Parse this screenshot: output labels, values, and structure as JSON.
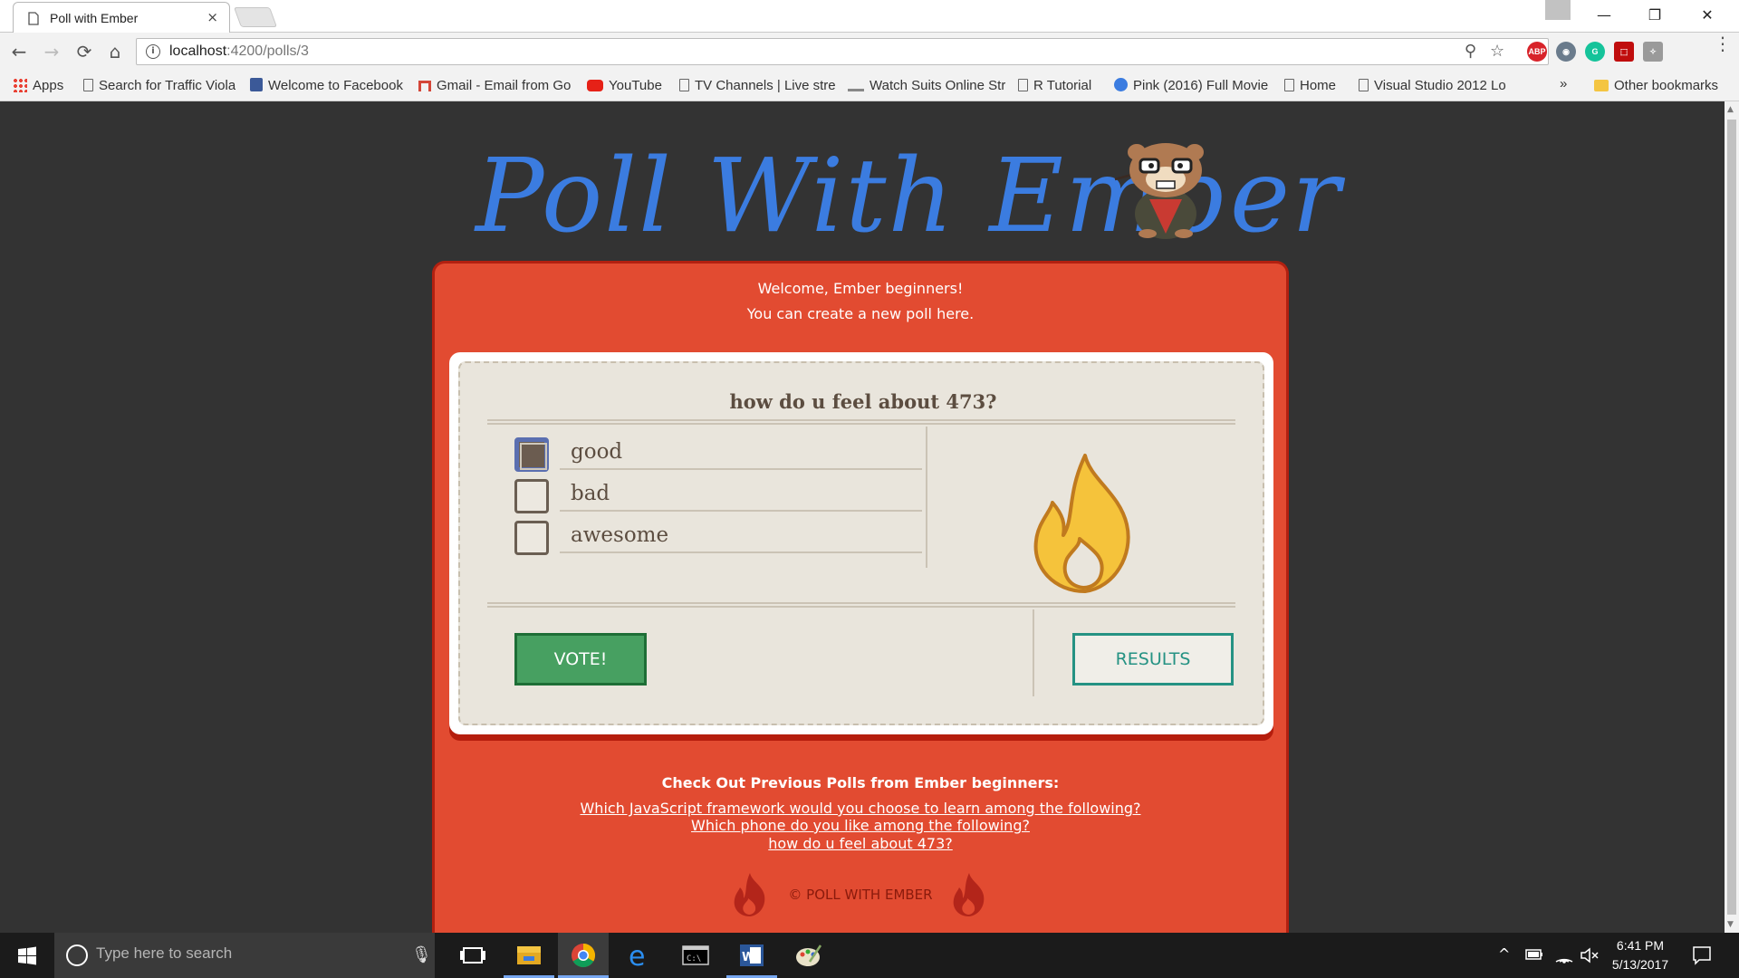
{
  "browser": {
    "tab_title": "Poll with Ember",
    "tab_close": "×",
    "window_minimize": "—",
    "window_restore": "❐",
    "window_close": "✕",
    "nav_back": "←",
    "nav_forward": "→",
    "nav_reload": "⟳",
    "nav_home": "⌂",
    "url_host": "localhost",
    "url_rest": ":4200/polls/3",
    "zoom_icon": "⚲",
    "star_icon": "☆",
    "extensions": [
      {
        "name": "adblock-plus",
        "label": "ABP",
        "color": "#d8232a"
      },
      {
        "name": "eye-extension",
        "label": "◉",
        "color": "#6a7b8c"
      },
      {
        "name": "grammarly",
        "label": "G",
        "color": "#15c39a"
      },
      {
        "name": "acrobat",
        "label": "⬚",
        "color": "#c00d0d"
      },
      {
        "name": "puzzle-extension",
        "label": "✧",
        "color": "#9a9a9a"
      }
    ],
    "menu": "⋮",
    "bookmarks": [
      {
        "label": "Apps",
        "icon": "apps-icon"
      },
      {
        "label": "Search for Traffic Viola",
        "icon": "doc-icon"
      },
      {
        "label": "Welcome to Facebook",
        "icon": "facebook-icon"
      },
      {
        "label": "Gmail - Email from Go",
        "icon": "gmail-icon"
      },
      {
        "label": "YouTube",
        "icon": "youtube-icon"
      },
      {
        "label": "TV Channels | Live stre",
        "icon": "doc-icon"
      },
      {
        "label": "Watch Suits Online Str",
        "icon": "plane-icon"
      },
      {
        "label": "R Tutorial",
        "icon": "doc-icon"
      },
      {
        "label": "Pink (2016) Full Movie",
        "icon": "play-icon"
      },
      {
        "label": "Home",
        "icon": "doc-icon"
      },
      {
        "label": "Visual Studio 2012 Lo",
        "icon": "doc-icon"
      }
    ],
    "bookmarks_overflow": "»",
    "other_bookmarks": "Other bookmarks"
  },
  "page": {
    "hero_title": "Poll With Ember",
    "welcome_line1": "Welcome, Ember beginners!",
    "welcome_line2": "You can create a new poll here.",
    "poll": {
      "question": "how do u feel about 473?",
      "options": [
        {
          "label": "good",
          "checked": true
        },
        {
          "label": "bad",
          "checked": false
        },
        {
          "label": "awesome",
          "checked": false
        }
      ],
      "vote_label": "VOTE!",
      "results_label": "RESULTS"
    },
    "previous_heading": "Check Out Previous Polls from Ember beginners:",
    "previous_polls": [
      "Which JavaScript framework would you choose to learn among the following?",
      "Which phone do you like among the following?",
      "how do u feel about 473?"
    ],
    "footer": "© POLL WITH EMBER",
    "colors": {
      "background": "#333333",
      "card": "#e24b31",
      "title": "#3b7ce0",
      "vote": "#47a061",
      "results": "#259283",
      "flame": "#f5c33b"
    }
  },
  "taskbar": {
    "search_placeholder": "Type here to search",
    "apps": [
      "task-view",
      "file-explorer",
      "chrome",
      "edge",
      "command-prompt",
      "word",
      "paint"
    ],
    "tray_chevron": "^",
    "time": "6:41 PM",
    "date": "5/13/2017"
  }
}
